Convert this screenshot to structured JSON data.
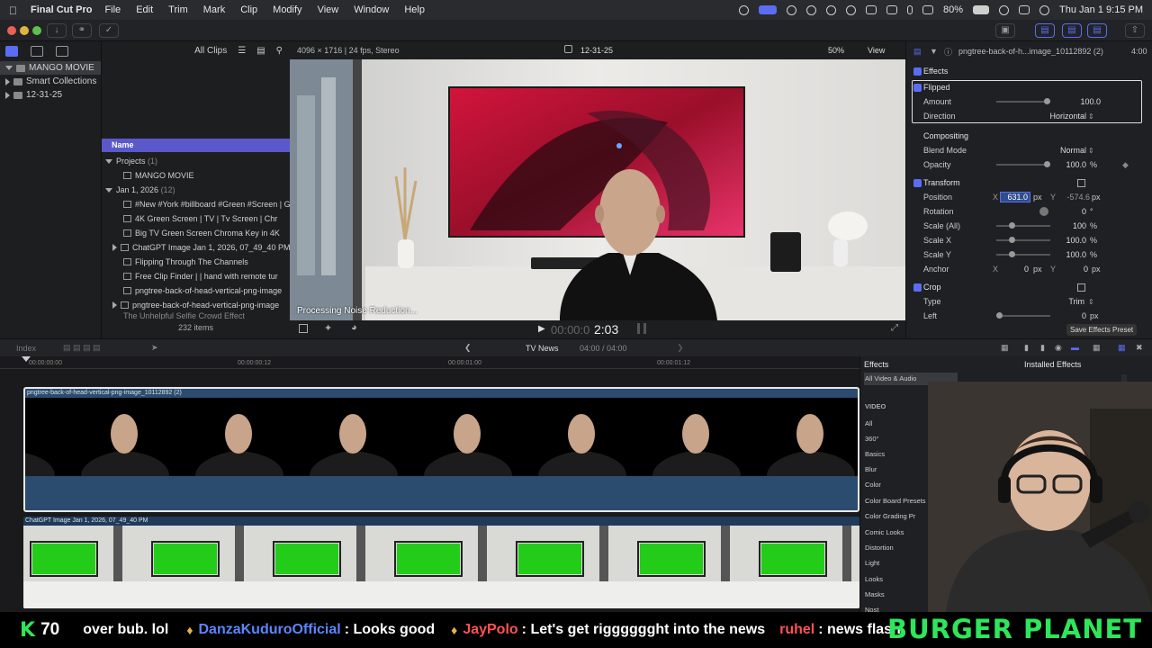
{
  "menubar": {
    "app": "Final Cut Pro",
    "items": [
      "File",
      "Edit",
      "Trim",
      "Mark",
      "Clip",
      "Modify",
      "View",
      "Window",
      "Help"
    ],
    "battery": "80%",
    "clock": "Thu Jan 1  9:15 PM"
  },
  "libraries": {
    "rows": [
      "MANGO MOVIE",
      "Smart Collections",
      "12-31-25"
    ]
  },
  "browser": {
    "filter": "All Clips",
    "column_name": "Name",
    "projects_label": "Projects",
    "projects_count": "(1)",
    "project_item": "MANGO MOVIE",
    "event_label": "Jan 1, 2026",
    "event_count": "(12)",
    "clips": [
      "#New #York #billboard #Green #Screen | G",
      "4K Green Screen  |  TV  |  Tv Screen  |  Chr",
      "Big TV Green Screen Chroma Key in 4K",
      "ChatGPT Image Jan 1, 2026, 07_49_40 PM",
      "Flipping Through The Channels",
      "Free Clip Finder  |  |  hand with remote tur",
      "pngtree-back-of-head-vertical-png-image",
      "pngtree-back-of-head-vertical-png-image",
      "The Unhelpful Selfie Crowd Effect"
    ],
    "item_count": "232 items"
  },
  "viewer": {
    "format": "4096 × 1716 | 24 fps, Stereo",
    "title": "12-31-25",
    "zoom": "50%",
    "view_label": "View",
    "processing": "Processing Noise Reduction...",
    "timecode_dim": "00:00:0",
    "timecode": "2:03"
  },
  "inspector": {
    "clip_name": "pngtree-back-of-h...image_10112892 (2)",
    "duration": "4:00",
    "effects": "Effects",
    "flipped": "Flipped",
    "amount_label": "Amount",
    "amount_value": "100.0",
    "direction_label": "Direction",
    "direction_value": "Horizontal",
    "compositing": "Compositing",
    "blend_label": "Blend Mode",
    "blend_value": "Normal",
    "opacity_label": "Opacity",
    "opacity_value": "100.0",
    "transform": "Transform",
    "position_label": "Position",
    "position_x": "631.0",
    "position_y": "-574.6",
    "rotation_label": "Rotation",
    "rotation_value": "0",
    "scale_all_label": "Scale (All)",
    "scale_all_value": "100",
    "scale_x_label": "Scale X",
    "scale_x_value": "100.0",
    "scale_y_label": "Scale Y",
    "scale_y_value": "100.0",
    "anchor_label": "Anchor",
    "anchor_x": "0",
    "anchor_y": "0",
    "crop": "Crop",
    "type_label": "Type",
    "type_value": "Trim",
    "left_label": "Left",
    "left_value": "0",
    "save_preset": "Save Effects Preset",
    "units": {
      "px": "px",
      "pct": "%",
      "deg": "°"
    },
    "axes": {
      "x": "X",
      "y": "Y"
    }
  },
  "timeline": {
    "index_label": "Index",
    "project": "TV News",
    "timecode": "04:00 / 04:00",
    "ruler": [
      "00:00:00:00",
      "00:00:00:12",
      "00:00:01:00",
      "00:00:01:12"
    ],
    "clip1": "pngtree-back-of-head-vertical-png-image_10112892 (2)",
    "clip2": "ChatGPT Image Jan 1, 2026, 07_49_40 PM"
  },
  "effects_browser": {
    "title": "Effects",
    "installed": "Installed Effects",
    "all": "All Video & Audio",
    "video": "VIDEO",
    "categories": [
      "All",
      "360°",
      "Basics",
      "Blur",
      "Color",
      "Color Board Presets",
      "Color Grading Pr",
      "Comic Looks",
      "Distortion",
      "Light",
      "Looks",
      "Masks",
      "Nost"
    ]
  },
  "ticker": {
    "k_label": "K",
    "k_count": "70",
    "text1": "over bub. lol",
    "user1": "DanzaKuduroOfficial",
    "msg1": ": Looks good",
    "user2": "JayPolo",
    "msg2": ": Let's get rigggggght into the news",
    "user3": "ruhel",
    "msg3": ": news flash",
    "brand": "BURGER PLANET"
  }
}
